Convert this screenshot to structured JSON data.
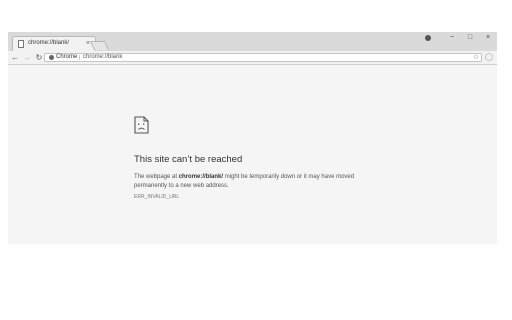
{
  "tab": {
    "title": "chrome://blank/",
    "close_glyph": "×",
    "icon": "page-icon"
  },
  "window_controls": {
    "minimize": "−",
    "maximize": "□",
    "close": "×"
  },
  "toolbar": {
    "back": "←",
    "forward": "→",
    "reload": "↻",
    "security_chip": "Chrome",
    "url": "chrome://blank",
    "star": "☆"
  },
  "error": {
    "title": "This site can’t be reached",
    "desc_prefix": "The webpage at ",
    "desc_url": "chrome://blank/",
    "desc_suffix": " might be temporarily down or it may have moved permanently to a new web address.",
    "code": "ERR_INVALID_URL"
  },
  "colors": {
    "page_bg": "#f5f5f5",
    "tabstrip_bg": "#dadada",
    "text": "#333333"
  }
}
